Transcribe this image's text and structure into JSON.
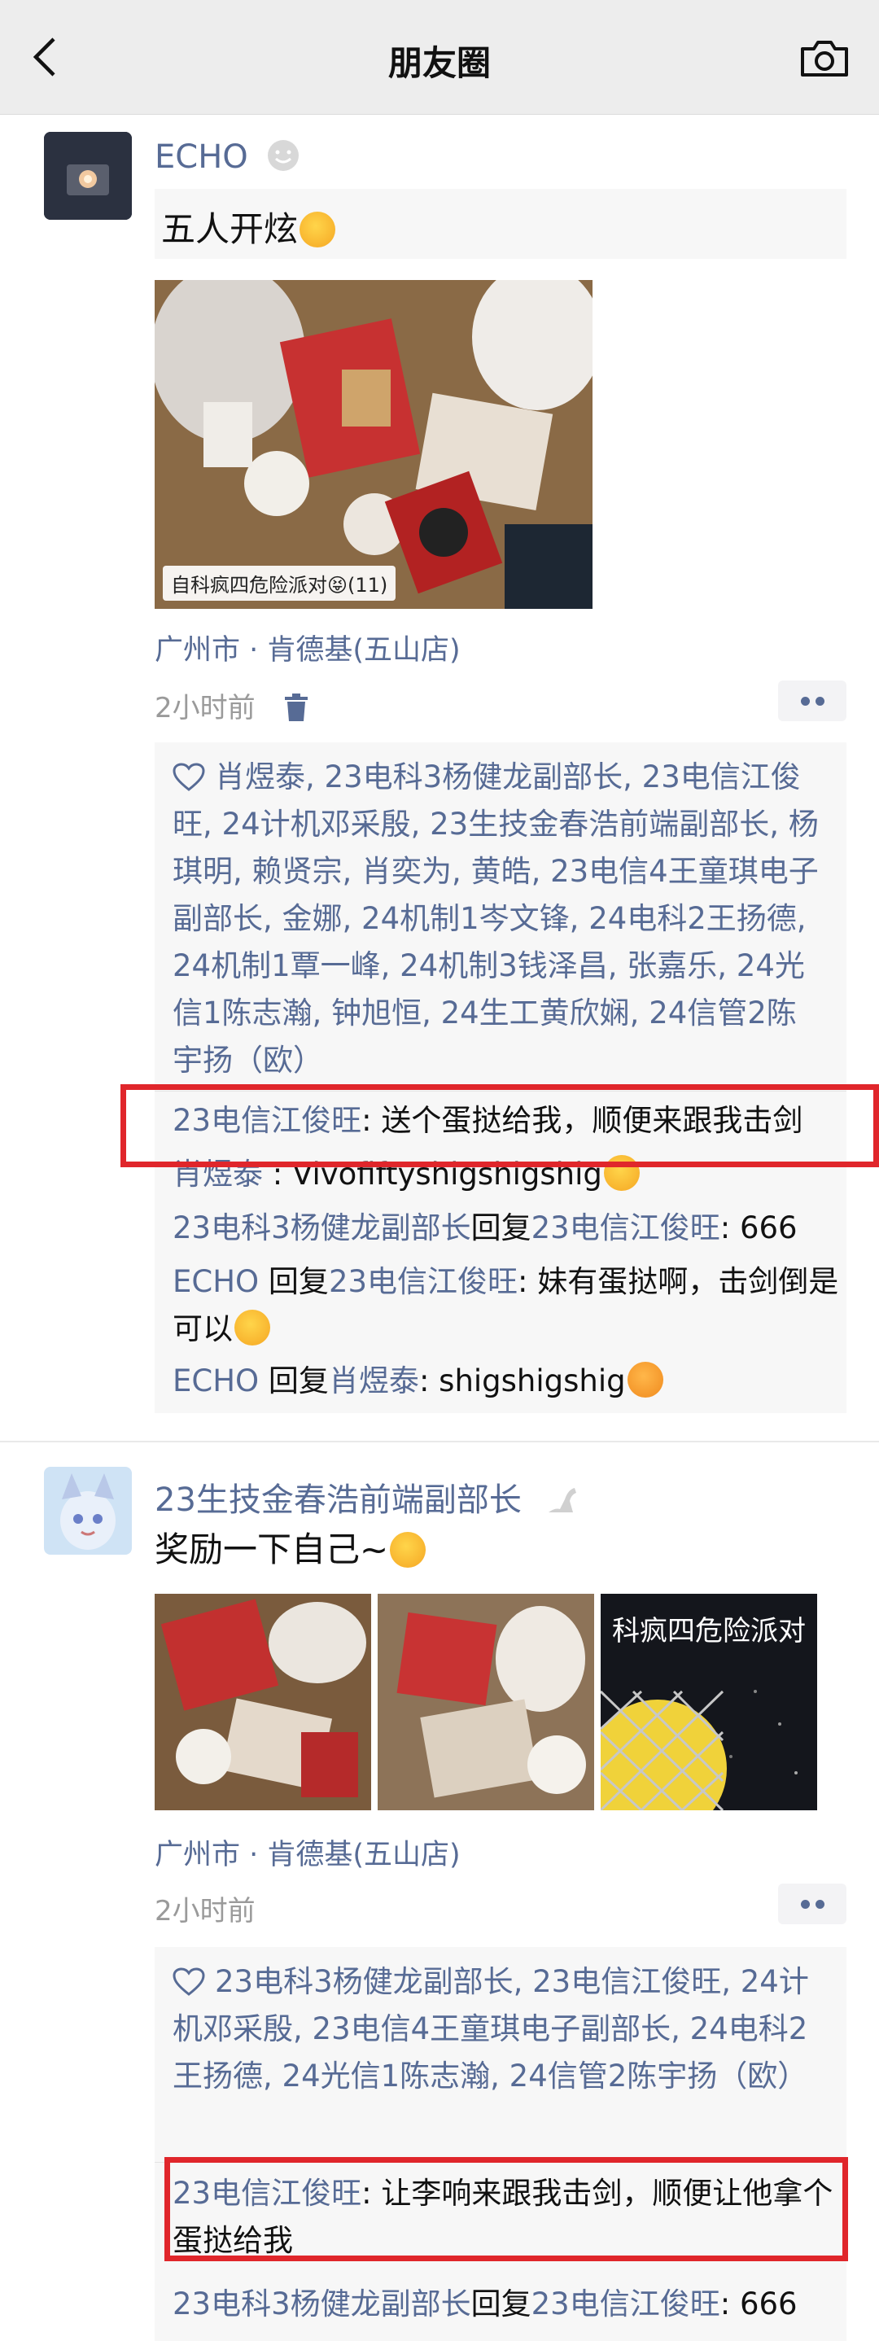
{
  "header": {
    "title": "朋友圈"
  },
  "post1": {
    "author": "ECHO",
    "text": "五人开炫",
    "photo_caption": "自科疯四危险派对😝(11)",
    "location": "广州市 · 肯德基(五山店)",
    "time": "2小时前",
    "likes": "肖煜泰, 23电科3杨健龙副部长, 23电信江俊旺, 24计机邓采殷, 23生技金春浩前端副部长, 杨琪明, 赖贤宗, 肖奕为, 黄皓, 23电信4王童琪电子副部长, 金娜, 24机制1岑文锋, 24电科2王扬德, 24机制1覃一峰, 24机制3钱泽昌, 张嘉乐, 24光信1陈志瀚, 钟旭恒, 24生工黄欣娴, 24信管2陈宇扬（欧）",
    "comments": [
      {
        "name": "23电信江俊旺",
        "text": ": 送个蛋挞给我，顺便来跟我击剑"
      },
      {
        "name": "肖煜泰",
        "text": " : Vivofiftyshigshigshig"
      },
      {
        "name": "23电科3杨健龙副部长",
        "reply_word": "回复",
        "reply_to": "23电信江俊旺",
        "text": ": 666"
      },
      {
        "name": "ECHO",
        "reply_word": " 回复",
        "reply_to": "23电信江俊旺",
        "text": ": 妹有蛋挞啊，击剑倒是可以"
      },
      {
        "name": "ECHO",
        "reply_word": " 回复",
        "reply_to": "肖煜泰",
        "text": ": shigshigshig"
      }
    ]
  },
  "post2": {
    "author": "23生技金春浩前端副部长",
    "text": "奖励一下自己~",
    "photo3_banner": "科疯四危险派对",
    "location": "广州市 · 肯德基(五山店)",
    "time": "2小时前",
    "likes": "23电科3杨健龙副部长, 23电信江俊旺, 24计机邓采殷, 23电信4王童琪电子副部长, 24电科2王扬德, 24光信1陈志瀚, 24信管2陈宇扬（欧）",
    "comments": [
      {
        "name": "23电信江俊旺",
        "text": ": 让李响来跟我击剑，顺便让他拿个蛋挞给我"
      },
      {
        "name": "23电科3杨健龙副部长",
        "reply_word": "回复",
        "reply_to": "23电信江俊旺",
        "text": ": 666"
      }
    ]
  },
  "colors": {
    "link": "#576b95",
    "highlight": "#e0262b",
    "box": "#f7f7f7"
  }
}
